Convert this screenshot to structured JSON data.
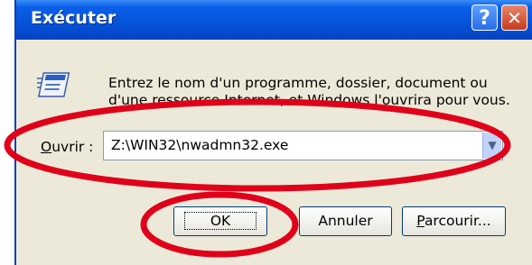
{
  "window": {
    "title": "Exécuter",
    "help_label": "?",
    "close_label": "✕"
  },
  "dialog": {
    "description": "Entrez le nom d'un programme, dossier, document ou d'une ressource Internet, et Windows l'ouvrira pour vous.",
    "open_label_hotkey": "O",
    "open_label_rest": "uvrir :",
    "open_value": "Z:\\WIN32\\nwadmn32.exe"
  },
  "buttons": {
    "ok": "OK",
    "cancel": "Annuler",
    "browse_hotkey": "P",
    "browse_rest": "arcourir..."
  },
  "icons": {
    "run": "run-program-icon",
    "dropdown": "chevron-down-icon"
  },
  "colors": {
    "titlebar": "#0653d8",
    "dialog_bg": "#ece9d8",
    "annotation_red": "#e0001a"
  }
}
